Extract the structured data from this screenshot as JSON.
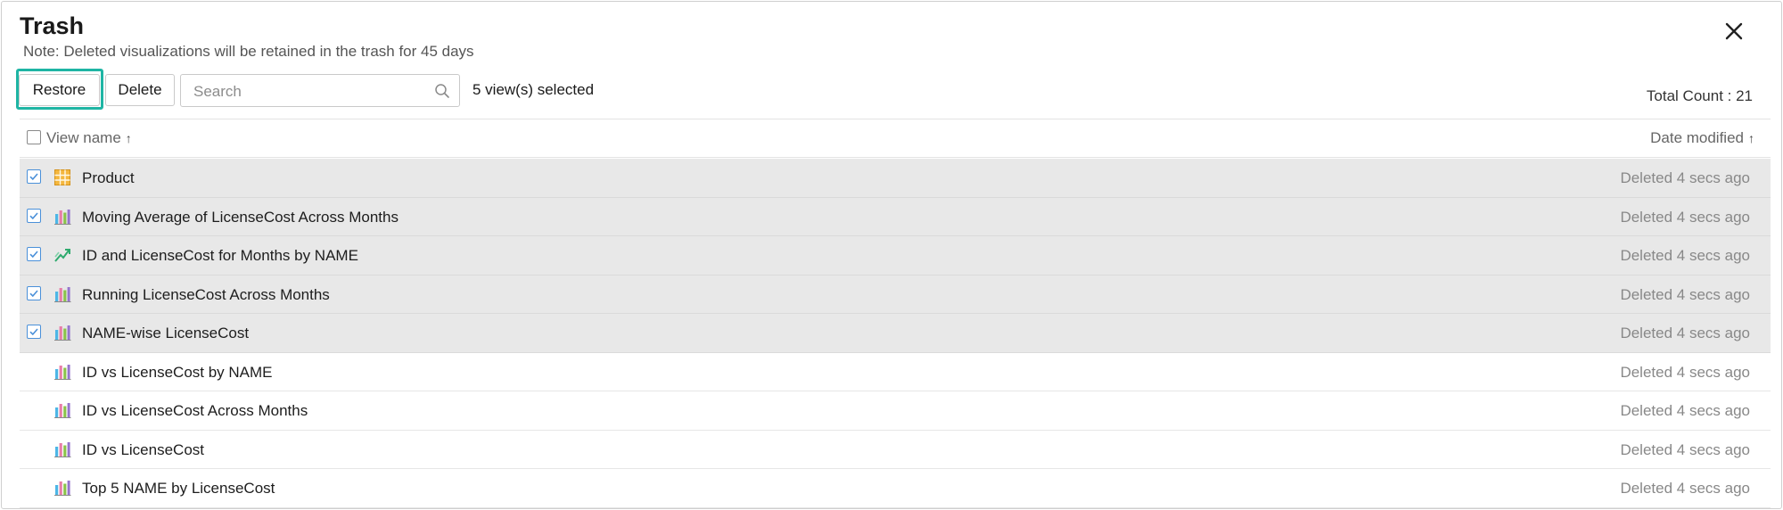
{
  "dialog": {
    "title": "Trash",
    "note": "Note: Deleted visualizations will be retained in the trash for 45 days"
  },
  "toolbar": {
    "restore_label": "Restore",
    "delete_label": "Delete",
    "search_placeholder": "Search",
    "selected_count": "5 view(s) selected",
    "total_count": "Total Count : 21",
    "accent_color": "#1fb5a4"
  },
  "table": {
    "col_name": "View name",
    "col_date": "Date modified",
    "sort_arrow": "↑",
    "rows": [
      {
        "name": "Product",
        "date": "Deleted 4 secs ago",
        "icon": "table-icon",
        "selected": true
      },
      {
        "name": "Moving Average of LicenseCost Across Months",
        "date": "Deleted 4 secs ago",
        "icon": "bar-chart-icon",
        "selected": true
      },
      {
        "name": "ID and LicenseCost for Months by NAME",
        "date": "Deleted 4 secs ago",
        "icon": "trend-chart-icon",
        "selected": true
      },
      {
        "name": "Running LicenseCost Across Months",
        "date": "Deleted 4 secs ago",
        "icon": "bar-chart-icon",
        "selected": true
      },
      {
        "name": "NAME-wise LicenseCost",
        "date": "Deleted 4 secs ago",
        "icon": "bar-chart-icon",
        "selected": true
      },
      {
        "name": "ID vs LicenseCost by NAME",
        "date": "Deleted 4 secs ago",
        "icon": "bar-chart-icon",
        "selected": false
      },
      {
        "name": "ID vs LicenseCost Across Months",
        "date": "Deleted 4 secs ago",
        "icon": "bar-chart-icon",
        "selected": false
      },
      {
        "name": "ID vs LicenseCost",
        "date": "Deleted 4 secs ago",
        "icon": "bar-chart-icon",
        "selected": false
      },
      {
        "name": "Top 5 NAME by LicenseCost",
        "date": "Deleted 4 secs ago",
        "icon": "bar-chart-icon",
        "selected": false
      }
    ]
  }
}
